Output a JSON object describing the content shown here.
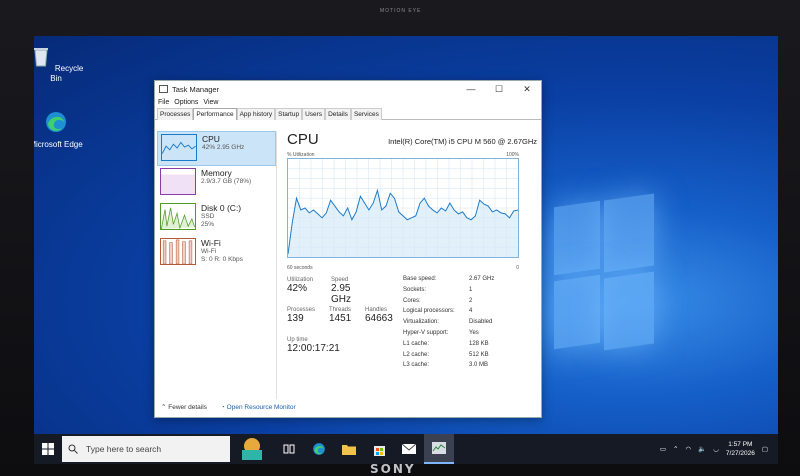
{
  "monitor": {
    "camera_label": "MOTION EYE",
    "brand": "SONY"
  },
  "desktop": {
    "icons": [
      {
        "label": "Recycle Bin",
        "icon": "recycle-bin-icon"
      },
      {
        "label": "Microsoft Edge",
        "icon": "edge-icon"
      }
    ]
  },
  "task_manager": {
    "title": "Task Manager",
    "window_buttons": {
      "minimize": "—",
      "maximize": "☐",
      "close": "✕"
    },
    "menu": [
      "File",
      "Options",
      "View"
    ],
    "tabs": [
      "Processes",
      "Performance",
      "App history",
      "Startup",
      "Users",
      "Details",
      "Services"
    ],
    "active_tab": "Performance",
    "sidebar": [
      {
        "name": "CPU",
        "line1": "42% 2.95 GHz",
        "line2": ""
      },
      {
        "name": "Memory",
        "line1": "2.9/3.7 GB (78%)",
        "line2": ""
      },
      {
        "name": "Disk 0 (C:)",
        "line1": "SSD",
        "line2": "25%"
      },
      {
        "name": "Wi-Fi",
        "line1": "Wi-Fi",
        "line2": "S: 0 R: 0 Kbps"
      }
    ],
    "cpu": {
      "heading": "CPU",
      "model": "Intel(R) Core(TM) i5 CPU M 560 @ 2.67GHz",
      "util_label": "% Utilization",
      "util_max": "100%",
      "time_label": "60 seconds",
      "zero": "0",
      "stats": {
        "utilization_label": "Utilization",
        "utilization": "42%",
        "speed_label": "Speed",
        "speed": "2.95 GHz",
        "processes_label": "Processes",
        "processes": "139",
        "threads_label": "Threads",
        "threads": "1451",
        "handles_label": "Handles",
        "handles": "64663",
        "uptime_label": "Up time",
        "uptime": "12:00:17:21"
      },
      "specs": [
        {
          "k": "Base speed:",
          "v": "2.67 GHz"
        },
        {
          "k": "Sockets:",
          "v": "1"
        },
        {
          "k": "Cores:",
          "v": "2"
        },
        {
          "k": "Logical processors:",
          "v": "4"
        },
        {
          "k": "Virtualization:",
          "v": "Disabled"
        },
        {
          "k": "Hyper-V support:",
          "v": "Yes"
        },
        {
          "k": "L1 cache:",
          "v": "128 KB"
        },
        {
          "k": "L2 cache:",
          "v": "512 KB"
        },
        {
          "k": "L3 cache:",
          "v": "3.0 MB"
        }
      ],
      "history_percent": [
        3,
        35,
        60,
        48,
        50,
        45,
        48,
        44,
        40,
        45,
        58,
        52,
        46,
        42,
        50,
        38,
        46,
        62,
        55,
        48,
        55,
        68,
        48,
        52,
        65,
        60,
        46,
        42,
        38,
        40,
        42,
        55,
        60,
        52,
        48,
        45,
        50,
        47,
        55,
        48,
        44,
        46,
        40,
        38,
        42,
        58,
        54,
        52,
        46,
        48,
        45,
        44,
        40,
        47,
        48
      ],
      "colors": {
        "line": "#1a7bc9",
        "fill": "#d6e9f8",
        "grid": "#d8e8f5"
      }
    },
    "footer": {
      "fewer": "Fewer details",
      "monitor": "Open Resource Monitor"
    }
  },
  "taskbar": {
    "search_placeholder": "Type here to search",
    "time": "1:57 PM",
    "date": "7/27/2026"
  }
}
